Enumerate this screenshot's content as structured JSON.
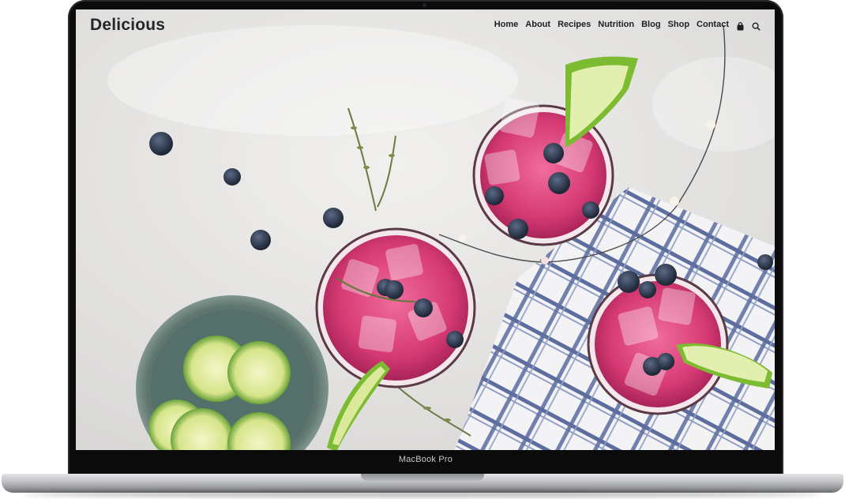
{
  "site": {
    "logo": "Delicious",
    "nav": [
      {
        "label": "Home"
      },
      {
        "label": "About"
      },
      {
        "label": "Recipes"
      },
      {
        "label": "Nutrition"
      },
      {
        "label": "Blog"
      },
      {
        "label": "Shop"
      },
      {
        "label": "Contact"
      }
    ],
    "icons": [
      "shopping-bag-icon",
      "search-icon"
    ]
  },
  "device": {
    "label": "MacBook Pro"
  },
  "colors": {
    "drink": "#d9366f",
    "lime": "#8cc63e",
    "blueberry": "#2b3650",
    "backdrop": "#e9e8e6",
    "cloth_stripe": "#4a5b8c"
  }
}
